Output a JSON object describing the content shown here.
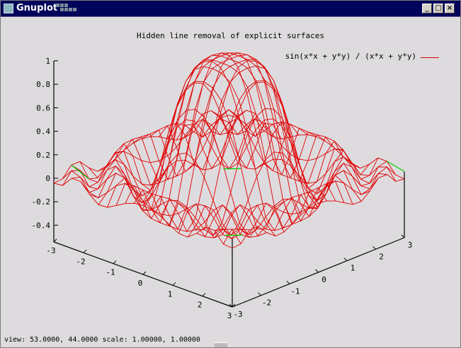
{
  "window": {
    "title": "Gnuplot",
    "buttons": {
      "minimize": "_",
      "maximize": "□",
      "close": "×"
    }
  },
  "plot": {
    "title": "Hidden line removal of explicit surfaces",
    "legend_label": "sin(x*x + y*y) / (x*x + y*y)",
    "colors": {
      "surface": "#e00000",
      "underside": "#00d000",
      "axes": "#000000"
    }
  },
  "chart_data": {
    "type": "surface",
    "function": "sin(x*x + y*y) / (x*x + y*y)",
    "title": "Hidden line removal of explicit surfaces",
    "legend": "sin(x*x + y*y) / (x*x + y*y)",
    "x_range": [
      -3,
      3
    ],
    "y_range": [
      -3,
      3
    ],
    "z_ticks": [
      "1",
      "0.8",
      "0.6",
      "0.4",
      "0.2",
      "0",
      "-0.2",
      "-0.4"
    ],
    "x_ticks": [
      "-3",
      "-2",
      "-1",
      "0",
      "1",
      "2",
      "3"
    ],
    "y_ticks": [
      "-3",
      "-2",
      "-1",
      "0",
      "1",
      "2",
      "3"
    ],
    "view": {
      "rot_x": 53,
      "rot_z": 44,
      "scale": 1,
      "scale_z": 1
    },
    "grid_samples": 20
  },
  "status": {
    "text": "view:  53.0000,  44.0000   scale:  1.00000,  1.00000"
  }
}
